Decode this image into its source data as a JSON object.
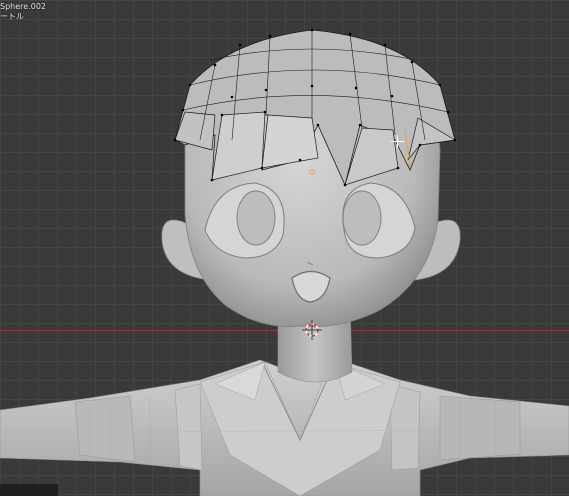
{
  "viewport": {
    "object_name": "Sphere.002",
    "sub_label": "ートル"
  },
  "colors": {
    "background": "#3a3a3a",
    "grid_line": "#464646",
    "x_axis": "#8a3b3f",
    "model_light": "#c8c8c8",
    "model_shadow": "#8a8a8a",
    "mesh_wire": "#1a1a1a",
    "vertex": "#000000",
    "selected": "#f39c3d"
  },
  "icons": {
    "cursor": "crosshair-icon",
    "origin": "origin-dot-icon",
    "3d_cursor": "3d-cursor-icon"
  }
}
